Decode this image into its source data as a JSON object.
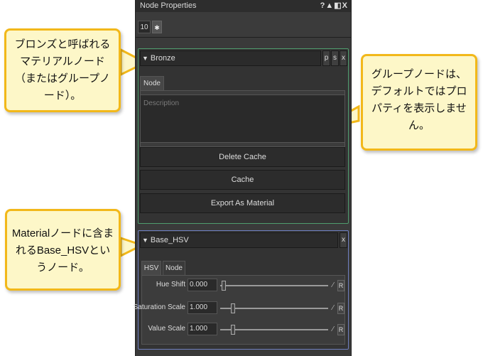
{
  "window": {
    "title": "Node Properties",
    "title_icons": "?▲◧X"
  },
  "toolbar": {
    "count_value": "10",
    "clear_label": "✱"
  },
  "bronze_node": {
    "name": "Bronze",
    "buttons": [
      "p",
      "s",
      "x"
    ],
    "tab": "Node",
    "description_placeholder": "Description",
    "actions": [
      "Delete Cache",
      "Cache",
      "Export As Material"
    ]
  },
  "hsv_node": {
    "name": "Base_HSV",
    "close": "x",
    "tabs": [
      "HSV",
      "Node"
    ],
    "params": [
      {
        "label": "Hue Shift",
        "value": "0.000",
        "slider": 0.0
      },
      {
        "label": "Saturation Scale",
        "value": "1.000",
        "slider": 0.1
      },
      {
        "label": "Value Scale",
        "value": "1.000",
        "slider": 0.1
      }
    ],
    "key_label": "⁄",
    "reset_label": "R"
  },
  "callouts": {
    "left_top": "ブロンズと呼ばれるマテリアルノード（またはグループノード）。",
    "right": "グループノードは、デフォルトではプロパティを表示しません。",
    "left_bottom": "Materialノードに含まれるBase_HSVというノード。"
  },
  "colors": {
    "callout_fill": "#fdf7c8",
    "callout_border": "#f2b81a",
    "bronze_border": "#4f9d6e",
    "hsv_border": "#6f7fc0"
  }
}
